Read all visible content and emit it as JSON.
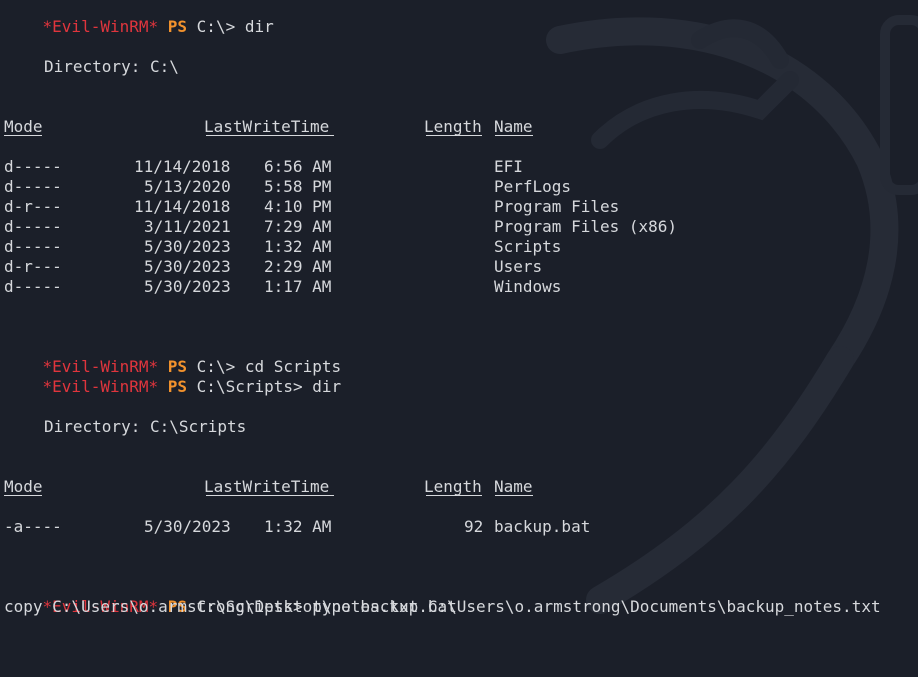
{
  "prompt": {
    "tag": "*Evil-WinRM*",
    "ps": "PS"
  },
  "accent_colors": {
    "prompt_tag": "#e0353d",
    "ps": "#f2922d",
    "background": "#1b1f29",
    "text": "#d6d8dc"
  },
  "commands": [
    "C:\\> dir",
    "C:\\> cd Scripts",
    "C:\\Scripts> dir",
    "C:\\Scripts> type backup.bat"
  ],
  "dir1": {
    "heading": "Directory: C:\\",
    "columns": [
      "Mode",
      "LastWriteTime",
      "Length",
      "Name"
    ],
    "rows": [
      {
        "mode": "d-----",
        "date": "11/14/2018",
        "time": "6:56 AM",
        "length": "",
        "name": "EFI"
      },
      {
        "mode": "d-----",
        "date": "5/13/2020",
        "time": "5:58 PM",
        "length": "",
        "name": "PerfLogs"
      },
      {
        "mode": "d-r---",
        "date": "11/14/2018",
        "time": "4:10 PM",
        "length": "",
        "name": "Program Files"
      },
      {
        "mode": "d-----",
        "date": "3/11/2021",
        "time": "7:29 AM",
        "length": "",
        "name": "Program Files (x86)"
      },
      {
        "mode": "d-----",
        "date": "5/30/2023",
        "time": "1:32 AM",
        "length": "",
        "name": "Scripts"
      },
      {
        "mode": "d-r---",
        "date": "5/30/2023",
        "time": "2:29 AM",
        "length": "",
        "name": "Users"
      },
      {
        "mode": "d-----",
        "date": "5/30/2023",
        "time": "1:17 AM",
        "length": "",
        "name": "Windows"
      }
    ]
  },
  "dir2": {
    "heading": "Directory: C:\\Scripts",
    "columns": [
      "Mode",
      "LastWriteTime",
      "Length",
      "Name"
    ],
    "rows": [
      {
        "mode": "-a----",
        "date": "5/30/2023",
        "time": "1:32 AM",
        "length": "92",
        "name": "backup.bat"
      }
    ]
  },
  "file_output": "copy C:\\Users\\o.armstrong\\Desktop\\notes.txt C:\\Users\\o.armstrong\\Documents\\backup_notes.txt"
}
